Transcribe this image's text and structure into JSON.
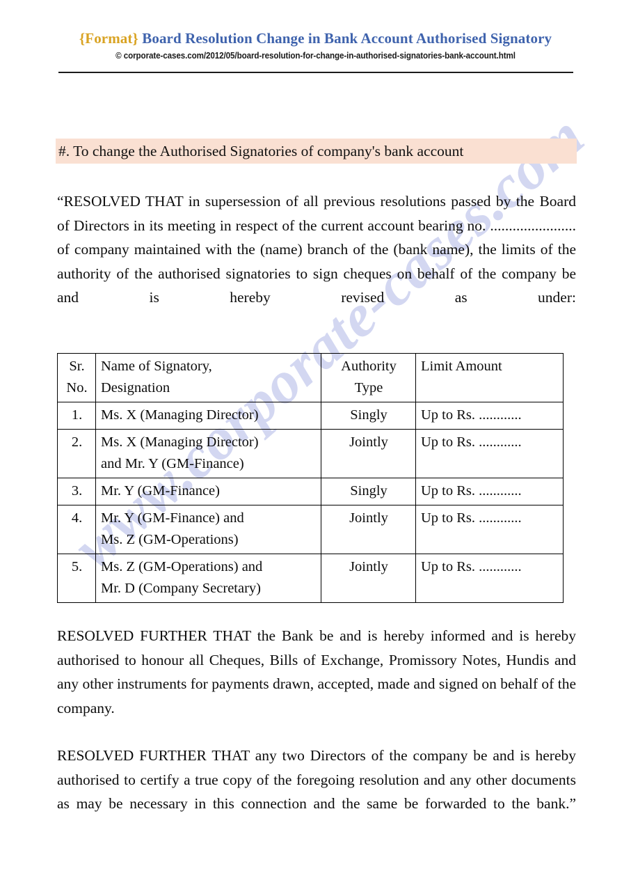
{
  "header": {
    "format_tag": "{Format}",
    "title": "Board Resolution Change in Bank Account Authorised Signatory",
    "copyright": "© corporate-cases.com/2012/05/board-resolution-for-change-in-authorised-signatories-bank-account.html"
  },
  "watermark": {
    "text": "www.corporate-cases.com",
    "color": "#ccd1ef"
  },
  "section": {
    "heading": "#. To change the Authorised Signatories of company's bank account",
    "heading_background": "#fae0d2"
  },
  "paragraphs": {
    "intro": "“RESOLVED THAT in supersession of all previous resolutions passed by the Board of Directors in its meeting in respect of the current account bearing no. ....................... of company maintained with the (name) branch of the (bank name), the limits of the authority of the authorised signatories to sign cheques on behalf of the company be and is hereby revised as under:",
    "bank_informed": "RESOLVED FURTHER THAT the Bank be and is hereby informed and is hereby authorised to honour all Cheques, Bills of Exchange, Promissory Notes, Hundis and any other instruments for payments drawn, accepted, made and signed on behalf of the company.",
    "certify": "RESOLVED FURTHER THAT any two Directors of the company be and is hereby authorised to certify a true copy of the foregoing resolution and any other documents as may be necessary in this connection and the same be forwarded to the bank.”"
  },
  "table": {
    "headers": {
      "srno": [
        "Sr.",
        "No."
      ],
      "name": [
        "Name of Signatory,",
        "Designation"
      ],
      "authority": [
        "Authority",
        "Type"
      ],
      "limit": [
        "Limit Amount"
      ]
    },
    "rows": [
      {
        "srno": "1.",
        "name_lines": [
          "Ms. X (Managing Director)"
        ],
        "authority": "Singly",
        "limit": "Up to Rs. ............"
      },
      {
        "srno": "2.",
        "name_lines": [
          "Ms. X (Managing Director)",
          "and Mr. Y (GM-Finance)"
        ],
        "authority": "Jointly",
        "limit": "Up to Rs. ............"
      },
      {
        "srno": "3.",
        "name_lines": [
          "Mr. Y (GM-Finance)"
        ],
        "authority": "Singly",
        "limit": "Up to Rs. ............"
      },
      {
        "srno": "4.",
        "name_lines": [
          "Mr. Y (GM-Finance) and",
          "Ms. Z (GM-Operations)"
        ],
        "authority": "Jointly",
        "limit": "Up to Rs. ............"
      },
      {
        "srno": "5.",
        "name_lines": [
          "Ms. Z (GM-Operations) and",
          "Mr. D (Company Secretary)"
        ],
        "authority": "Jointly",
        "limit": "Up to Rs. ............"
      }
    ]
  },
  "colors": {
    "format_tag": "#d9a323",
    "header_title": "#3f63ad",
    "body_text": "#0d0d0d",
    "table_border": "#000000"
  }
}
